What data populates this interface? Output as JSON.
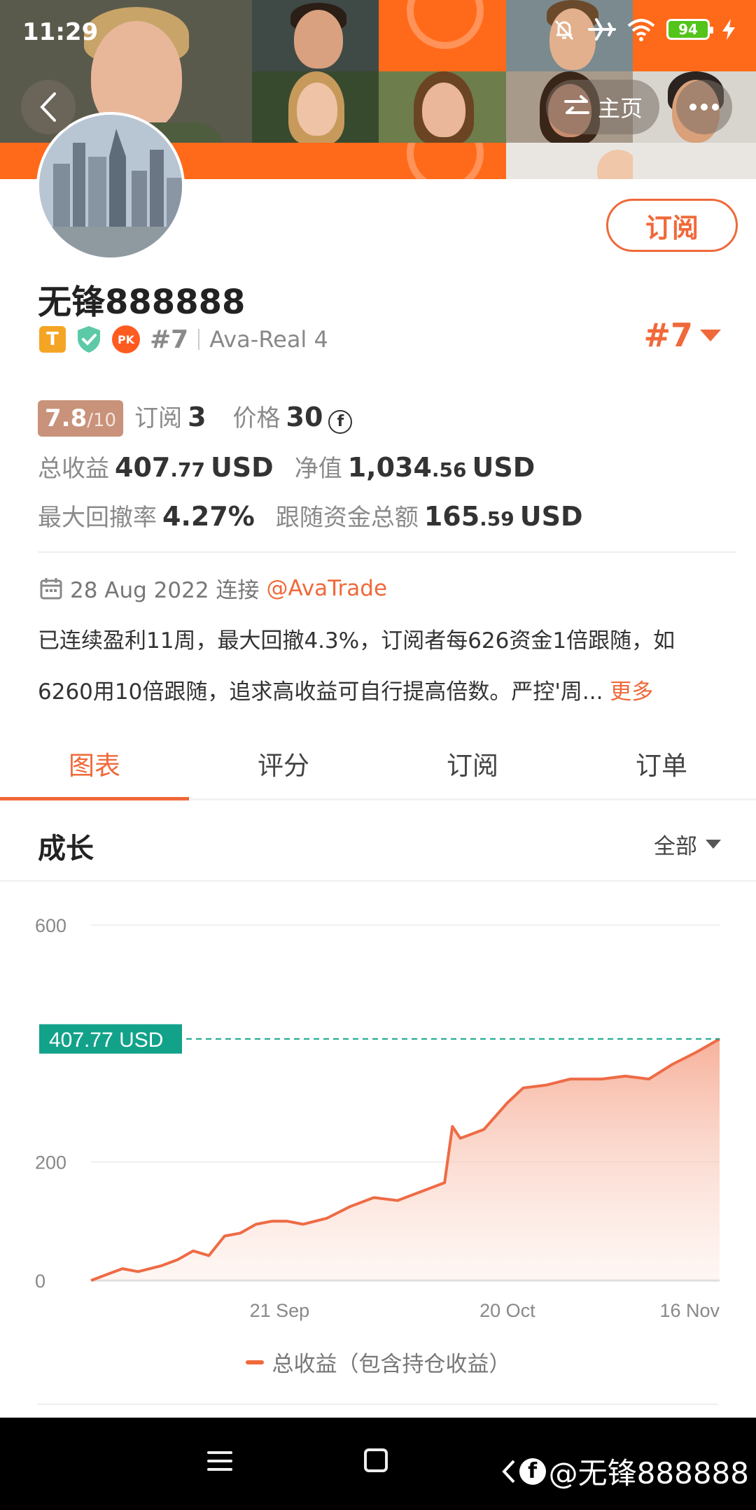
{
  "status_bar": {
    "time": "11:29",
    "battery": "94"
  },
  "header": {
    "home_label": "主页"
  },
  "profile": {
    "subscribe_label": "订阅",
    "username": "无锋888888",
    "badge_t": "T",
    "badge_pk": "PK",
    "rank": "#7",
    "account": "Ava-Real 4",
    "rank_right": "#7"
  },
  "stats": {
    "score": "7.8",
    "score_den": "/10",
    "subscribe_label": "订阅",
    "subscribe_count": "3",
    "price_label": "价格",
    "price": "30",
    "coin_symbol": "f",
    "total_profit_label": "总收益",
    "total_profit_int": "407",
    "total_profit_dec": ".77",
    "currency": "USD",
    "equity_label": "净值",
    "equity_int": "1,034",
    "equity_dec": ".56",
    "drawdown_label": "最大回撤率",
    "drawdown": "4.27%",
    "follow_label": "跟随资金总额",
    "follow_int": "165",
    "follow_dec": ".59"
  },
  "connect": {
    "date": "28 Aug 2022 连接",
    "broker": "@AvaTrade"
  },
  "description": {
    "line1": "已连续盈利11周，最大回撤4.3%，订阅者每626资金1倍跟随，如",
    "line2": "6260用10倍跟随，追求高收益可自行提高倍数。严控'周...",
    "more": "更多"
  },
  "tabs": [
    {
      "label": "图表",
      "active": true
    },
    {
      "label": "评分",
      "active": false
    },
    {
      "label": "订阅",
      "active": false
    },
    {
      "label": "订单",
      "active": false
    }
  ],
  "chart_section": {
    "title": "成长",
    "range": "全部"
  },
  "colors": {
    "accent": "#f0693a",
    "marker": "#12a28a",
    "score_bg": "#c9927a"
  },
  "chart_data": {
    "type": "area",
    "ylim": [
      0,
      600
    ],
    "y_ticks": [
      0,
      200,
      600
    ],
    "x_ticks": [
      "21 Sep",
      "20 Oct",
      "16 Nov"
    ],
    "x_tick_dates": [
      "2022-09-21",
      "2022-10-20",
      "2022-11-16"
    ],
    "marker_label": "407.77 USD",
    "marker_value": 407.77,
    "series": [
      {
        "name": "总收益（包含持仓收益）",
        "x": [
          "2022-08-28",
          "2022-08-30",
          "2022-09-01",
          "2022-09-03",
          "2022-09-06",
          "2022-09-08",
          "2022-09-10",
          "2022-09-12",
          "2022-09-14",
          "2022-09-16",
          "2022-09-18",
          "2022-09-20",
          "2022-09-22",
          "2022-09-24",
          "2022-09-27",
          "2022-09-30",
          "2022-10-03",
          "2022-10-06",
          "2022-10-09",
          "2022-10-12",
          "2022-10-13",
          "2022-10-14",
          "2022-10-15",
          "2022-10-17",
          "2022-10-20",
          "2022-10-22",
          "2022-10-25",
          "2022-10-28",
          "2022-11-01",
          "2022-11-04",
          "2022-11-07",
          "2022-11-10",
          "2022-11-13",
          "2022-11-16"
        ],
        "values": [
          0,
          10,
          20,
          15,
          25,
          35,
          50,
          42,
          75,
          80,
          95,
          100,
          100,
          95,
          105,
          125,
          140,
          135,
          150,
          165,
          260,
          240,
          245,
          255,
          300,
          325,
          330,
          340,
          340,
          345,
          340,
          365,
          385,
          407.77
        ]
      }
    ]
  },
  "navbar": {
    "watermark": "@无锋888888"
  }
}
